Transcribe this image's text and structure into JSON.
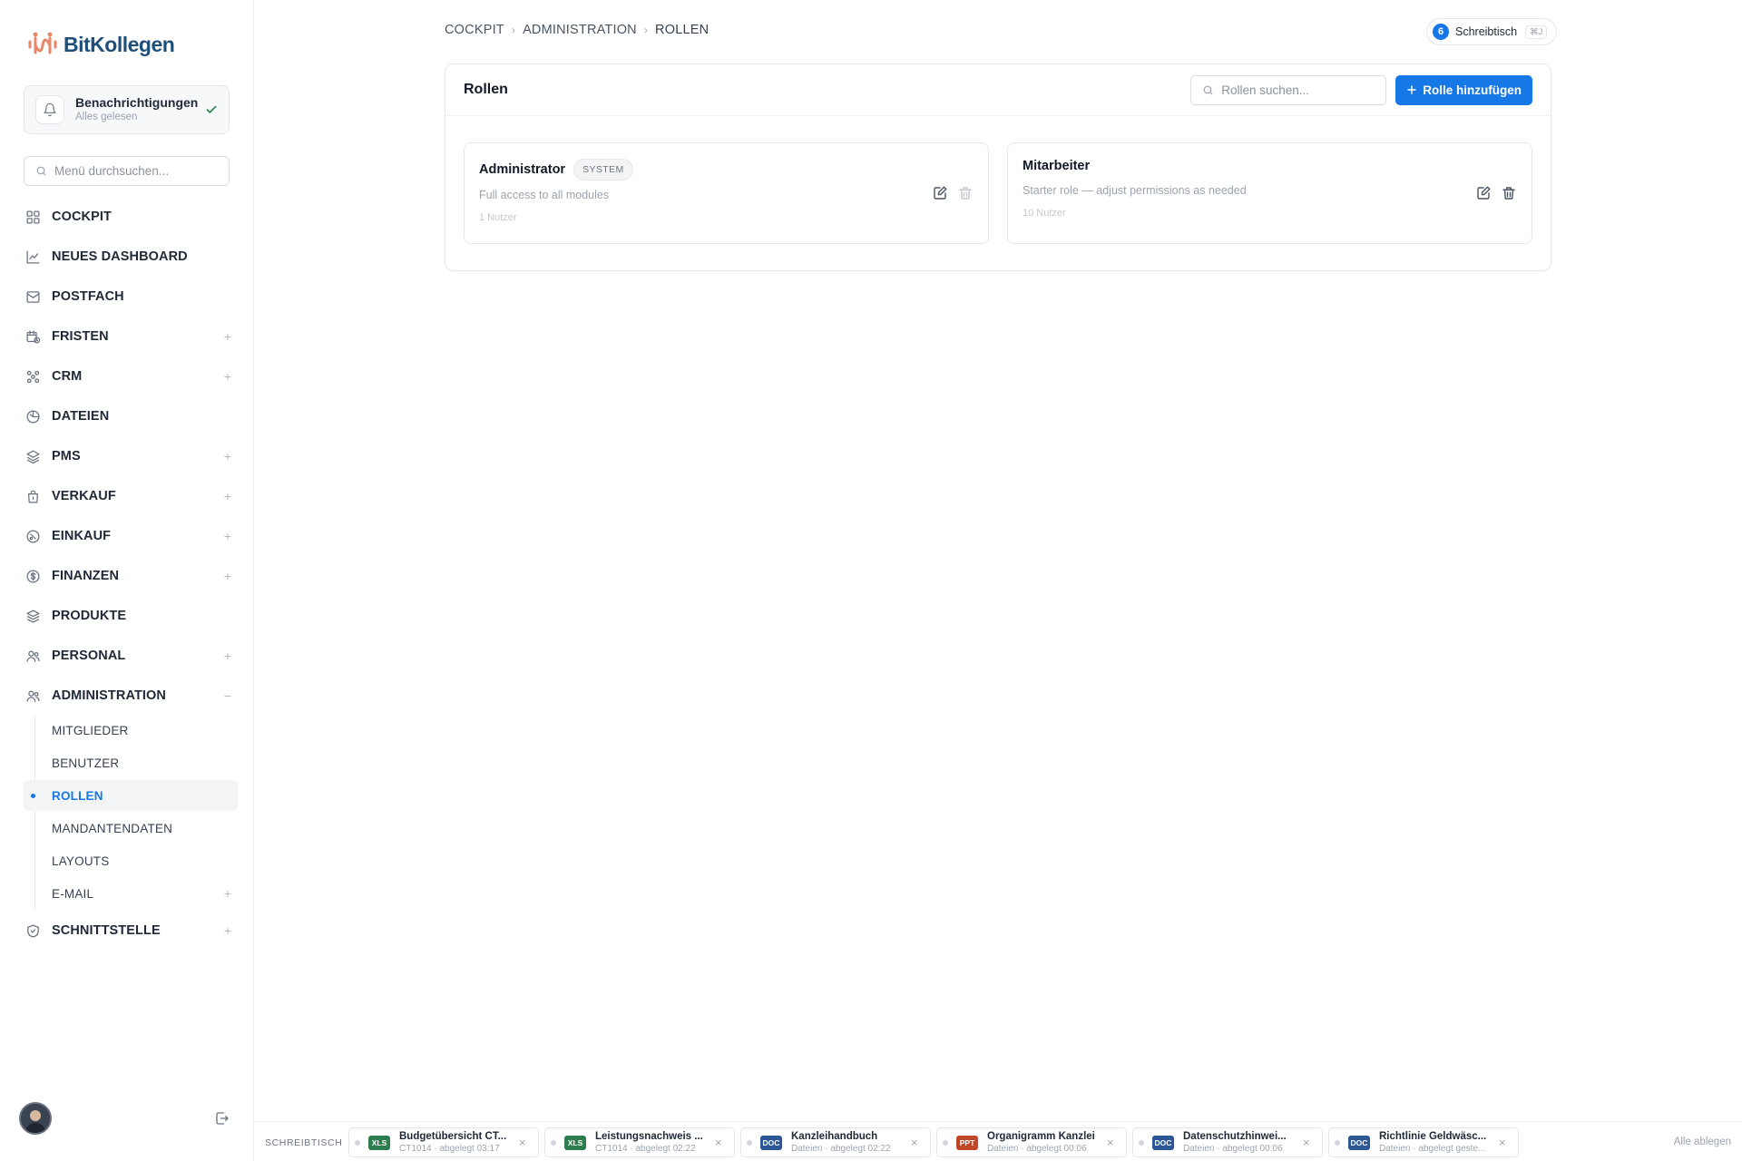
{
  "brand": {
    "name": "BitKollegen"
  },
  "notifications": {
    "title": "Benachrichtigungen",
    "status": "Alles gelesen"
  },
  "menu_search": {
    "placeholder": "Menü durchsuchen..."
  },
  "nav": {
    "items": [
      {
        "label": "COCKPIT",
        "icon": "grid-icon",
        "expandable": false
      },
      {
        "label": "NEUES DASHBOARD",
        "icon": "chart-line-icon",
        "expandable": false
      },
      {
        "label": "POSTFACH",
        "icon": "inbox-icon",
        "expandable": false
      },
      {
        "label": "FRISTEN",
        "icon": "calendar-clock-icon",
        "expandable": true
      },
      {
        "label": "CRM",
        "icon": "network-icon",
        "expandable": true
      },
      {
        "label": "DATEIEN",
        "icon": "folder-icon",
        "expandable": false
      },
      {
        "label": "PMS",
        "icon": "layers-icon",
        "expandable": true
      },
      {
        "label": "VERKAUF",
        "icon": "shopping-bag-icon",
        "expandable": true
      },
      {
        "label": "EINKAUF",
        "icon": "tag-icon",
        "expandable": true
      },
      {
        "label": "FINANZEN",
        "icon": "dollar-circle-icon",
        "expandable": true
      },
      {
        "label": "PRODUKTE",
        "icon": "stack-icon",
        "expandable": false
      },
      {
        "label": "PERSONAL",
        "icon": "users-icon",
        "expandable": true
      },
      {
        "label": "ADMINISTRATION",
        "icon": "users-cog-icon",
        "expandable": true,
        "expanded": true
      },
      {
        "label": "SCHNITTSTELLE",
        "icon": "shield-check-icon",
        "expandable": true
      }
    ],
    "admin_sub": [
      {
        "label": "MITGLIEDER"
      },
      {
        "label": "BENUTZER"
      },
      {
        "label": "ROLLEN",
        "active": true
      },
      {
        "label": "MANDANTENDATEN"
      },
      {
        "label": "LAYOUTS"
      },
      {
        "label": "E-MAIL",
        "expandable": true
      }
    ],
    "toggle_plus": "+",
    "toggle_minus": "−"
  },
  "breadcrumb": {
    "items": [
      "COCKPIT",
      "ADMINISTRATION",
      "ROLLEN"
    ],
    "separator": "›"
  },
  "desk_pill": {
    "count": "6",
    "label": "Schreibtisch",
    "shortcut": "⌘J"
  },
  "roles": {
    "title": "Rollen",
    "search_placeholder": "Rollen suchen...",
    "add_label": "Rolle hinzufügen",
    "items": [
      {
        "name": "Administrator",
        "badge": "SYSTEM",
        "description": "Full access to all modules",
        "users": "1 Nutzer"
      },
      {
        "name": "Mitarbeiter",
        "badge": "",
        "description": "Starter role — adjust permissions as needed",
        "users": "10 Nutzer"
      }
    ]
  },
  "deskbar": {
    "label": "SCHREIBTISCH",
    "all_label": "Alle ablegen",
    "files": [
      {
        "type": "XLS",
        "color": "#2e7d4f",
        "name": "Budgetübersicht CT...",
        "meta": "CT1014 · abgelegt 03:17"
      },
      {
        "type": "XLS",
        "color": "#2e7d4f",
        "name": "Leistungsnachweis ...",
        "meta": "CT1014 · abgelegt 02:22"
      },
      {
        "type": "DOC",
        "color": "#2b5797",
        "name": "Kanzleihandbuch",
        "meta": "Dateien · abgelegt 02:22"
      },
      {
        "type": "PPT",
        "color": "#c0462a",
        "name": "Organigramm Kanzlei",
        "meta": "Dateien · abgelegt 00:06"
      },
      {
        "type": "DOC",
        "color": "#2b5797",
        "name": "Datenschutzhinwei...",
        "meta": "Dateien · abgelegt 00:06"
      },
      {
        "type": "DOC",
        "color": "#2b5797",
        "name": "Richtlinie Geldwäsc...",
        "meta": "Dateien · abgelegt geste..."
      }
    ],
    "close_glyph": "×"
  },
  "colors": {
    "accent": "#1677e6",
    "brand_text": "#1f4e79",
    "brand_mark": "#e8866a"
  }
}
